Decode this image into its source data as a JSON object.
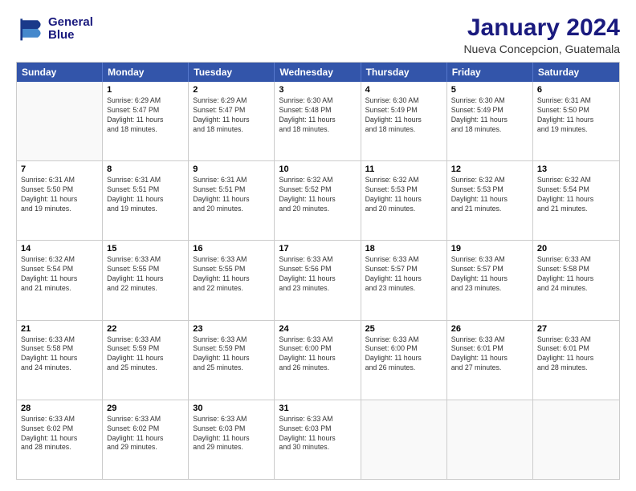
{
  "logo": {
    "line1": "General",
    "line2": "Blue"
  },
  "title": "January 2024",
  "subtitle": "Nueva Concepcion, Guatemala",
  "header_days": [
    "Sunday",
    "Monday",
    "Tuesday",
    "Wednesday",
    "Thursday",
    "Friday",
    "Saturday"
  ],
  "weeks": [
    [
      {
        "day": "",
        "info": ""
      },
      {
        "day": "1",
        "info": "Sunrise: 6:29 AM\nSunset: 5:47 PM\nDaylight: 11 hours\nand 18 minutes."
      },
      {
        "day": "2",
        "info": "Sunrise: 6:29 AM\nSunset: 5:47 PM\nDaylight: 11 hours\nand 18 minutes."
      },
      {
        "day": "3",
        "info": "Sunrise: 6:30 AM\nSunset: 5:48 PM\nDaylight: 11 hours\nand 18 minutes."
      },
      {
        "day": "4",
        "info": "Sunrise: 6:30 AM\nSunset: 5:49 PM\nDaylight: 11 hours\nand 18 minutes."
      },
      {
        "day": "5",
        "info": "Sunrise: 6:30 AM\nSunset: 5:49 PM\nDaylight: 11 hours\nand 18 minutes."
      },
      {
        "day": "6",
        "info": "Sunrise: 6:31 AM\nSunset: 5:50 PM\nDaylight: 11 hours\nand 19 minutes."
      }
    ],
    [
      {
        "day": "7",
        "info": "Sunrise: 6:31 AM\nSunset: 5:50 PM\nDaylight: 11 hours\nand 19 minutes."
      },
      {
        "day": "8",
        "info": "Sunrise: 6:31 AM\nSunset: 5:51 PM\nDaylight: 11 hours\nand 19 minutes."
      },
      {
        "day": "9",
        "info": "Sunrise: 6:31 AM\nSunset: 5:51 PM\nDaylight: 11 hours\nand 20 minutes."
      },
      {
        "day": "10",
        "info": "Sunrise: 6:32 AM\nSunset: 5:52 PM\nDaylight: 11 hours\nand 20 minutes."
      },
      {
        "day": "11",
        "info": "Sunrise: 6:32 AM\nSunset: 5:53 PM\nDaylight: 11 hours\nand 20 minutes."
      },
      {
        "day": "12",
        "info": "Sunrise: 6:32 AM\nSunset: 5:53 PM\nDaylight: 11 hours\nand 21 minutes."
      },
      {
        "day": "13",
        "info": "Sunrise: 6:32 AM\nSunset: 5:54 PM\nDaylight: 11 hours\nand 21 minutes."
      }
    ],
    [
      {
        "day": "14",
        "info": "Sunrise: 6:32 AM\nSunset: 5:54 PM\nDaylight: 11 hours\nand 21 minutes."
      },
      {
        "day": "15",
        "info": "Sunrise: 6:33 AM\nSunset: 5:55 PM\nDaylight: 11 hours\nand 22 minutes."
      },
      {
        "day": "16",
        "info": "Sunrise: 6:33 AM\nSunset: 5:55 PM\nDaylight: 11 hours\nand 22 minutes."
      },
      {
        "day": "17",
        "info": "Sunrise: 6:33 AM\nSunset: 5:56 PM\nDaylight: 11 hours\nand 23 minutes."
      },
      {
        "day": "18",
        "info": "Sunrise: 6:33 AM\nSunset: 5:57 PM\nDaylight: 11 hours\nand 23 minutes."
      },
      {
        "day": "19",
        "info": "Sunrise: 6:33 AM\nSunset: 5:57 PM\nDaylight: 11 hours\nand 23 minutes."
      },
      {
        "day": "20",
        "info": "Sunrise: 6:33 AM\nSunset: 5:58 PM\nDaylight: 11 hours\nand 24 minutes."
      }
    ],
    [
      {
        "day": "21",
        "info": "Sunrise: 6:33 AM\nSunset: 5:58 PM\nDaylight: 11 hours\nand 24 minutes."
      },
      {
        "day": "22",
        "info": "Sunrise: 6:33 AM\nSunset: 5:59 PM\nDaylight: 11 hours\nand 25 minutes."
      },
      {
        "day": "23",
        "info": "Sunrise: 6:33 AM\nSunset: 5:59 PM\nDaylight: 11 hours\nand 25 minutes."
      },
      {
        "day": "24",
        "info": "Sunrise: 6:33 AM\nSunset: 6:00 PM\nDaylight: 11 hours\nand 26 minutes."
      },
      {
        "day": "25",
        "info": "Sunrise: 6:33 AM\nSunset: 6:00 PM\nDaylight: 11 hours\nand 26 minutes."
      },
      {
        "day": "26",
        "info": "Sunrise: 6:33 AM\nSunset: 6:01 PM\nDaylight: 11 hours\nand 27 minutes."
      },
      {
        "day": "27",
        "info": "Sunrise: 6:33 AM\nSunset: 6:01 PM\nDaylight: 11 hours\nand 28 minutes."
      }
    ],
    [
      {
        "day": "28",
        "info": "Sunrise: 6:33 AM\nSunset: 6:02 PM\nDaylight: 11 hours\nand 28 minutes."
      },
      {
        "day": "29",
        "info": "Sunrise: 6:33 AM\nSunset: 6:02 PM\nDaylight: 11 hours\nand 29 minutes."
      },
      {
        "day": "30",
        "info": "Sunrise: 6:33 AM\nSunset: 6:03 PM\nDaylight: 11 hours\nand 29 minutes."
      },
      {
        "day": "31",
        "info": "Sunrise: 6:33 AM\nSunset: 6:03 PM\nDaylight: 11 hours\nand 30 minutes."
      },
      {
        "day": "",
        "info": ""
      },
      {
        "day": "",
        "info": ""
      },
      {
        "day": "",
        "info": ""
      }
    ]
  ]
}
